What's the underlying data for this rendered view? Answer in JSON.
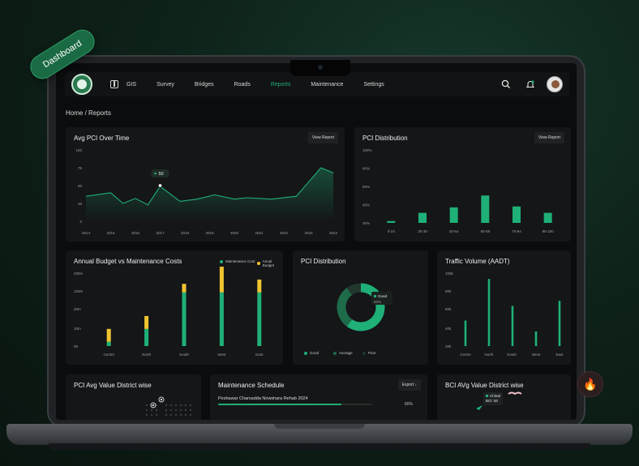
{
  "badge": "Dashboard",
  "nav": {
    "items": [
      {
        "label": "GIS",
        "active": false
      },
      {
        "label": "Survey",
        "active": false
      },
      {
        "label": "Bridges",
        "active": false
      },
      {
        "label": "Roads",
        "active": false
      },
      {
        "label": "Reports",
        "active": true
      },
      {
        "label": "Maintenance",
        "active": false
      },
      {
        "label": "Settings",
        "active": false
      }
    ]
  },
  "breadcrumb": "Home / Reports",
  "cards": {
    "avg_pci": {
      "title": "Avg PCI Over Time",
      "button": "View Report"
    },
    "pci_dist": {
      "title": "PCI Distribution",
      "button": "View Report"
    },
    "budget": {
      "title": "Annual Budget vs Maintenance Costs",
      "legend": [
        "Maintenance Cost",
        "Anual Budget"
      ]
    },
    "pci_donut": {
      "title": "PCI Distribution",
      "tooltip_label": "Good",
      "tooltip_value": "60%",
      "legend": [
        "Good",
        "Avorage",
        "Poor"
      ]
    },
    "traffic": {
      "title": "Traffic Volume (AADT)"
    },
    "pci_avg_district": {
      "title": "PCI Avg  Value District wise"
    },
    "schedule": {
      "title": "Maintenance Schedule",
      "button": "Export",
      "row_label": "Peshawar Charsadda Nowshara Rehab 2024",
      "row_value": "80%",
      "progress": 0.8
    },
    "bci_district": {
      "title": "BCI AVg Value District wise",
      "tooltip_label": "Chitral",
      "tooltip_value": "BCI: 50"
    }
  },
  "colors": {
    "accent": "#1fb077",
    "yellow": "#f0c431",
    "card": "#141618"
  },
  "chart_data": [
    {
      "type": "line",
      "title": "Avg PCI Over Time",
      "x": [
        "2014",
        "2015",
        "2016",
        "2017",
        "2018",
        "2019",
        "2020",
        "2021",
        "2022",
        "2023",
        "2024"
      ],
      "values": [
        35,
        40,
        25,
        32,
        23,
        49,
        28,
        31,
        37,
        31,
        33,
        31,
        35,
        75,
        68
      ],
      "point_x": [
        2014,
        2015,
        2015.5,
        2016,
        2016.5,
        2017,
        2017.8,
        2018.5,
        2019.2,
        2020,
        2020.5,
        2021.5,
        2022.5,
        2023.5,
        2024
      ],
      "annotation": {
        "label": "50",
        "x": 2017,
        "value": 50
      },
      "ylim": [
        0,
        100
      ],
      "yticks": [
        "0",
        "25",
        "50",
        "75",
        "100"
      ]
    },
    {
      "type": "bar",
      "title": "PCI Distribution",
      "categories": [
        "0-24",
        "25-39",
        "40-54",
        "55-69",
        "70-84",
        "85-100"
      ],
      "values": [
        22,
        31,
        37,
        50,
        38,
        31
      ],
      "ylim": [
        20,
        100
      ],
      "yticks": [
        "20%",
        "40%",
        "60%",
        "80%",
        "100%"
      ]
    },
    {
      "type": "bar",
      "title": "Annual Budget vs Maintenance Costs",
      "categories": [
        "Centre",
        "North",
        "South",
        "West",
        "East"
      ],
      "series": [
        {
          "name": "Maintenance Cost",
          "values": [
            10,
            40,
            125,
            125,
            125
          ]
        },
        {
          "name": "Anual Budget",
          "values": [
            30,
            30,
            20,
            60,
            30
          ]
        }
      ],
      "yticks": [
        "00",
        "10m",
        "40m",
        "100m",
        "200m"
      ]
    },
    {
      "type": "pie",
      "title": "PCI Distribution",
      "categories": [
        "Good",
        "Avorage",
        "Poor"
      ],
      "values": [
        60,
        30,
        10
      ]
    },
    {
      "type": "bar",
      "title": "Traffic Volume (AADT)",
      "categories": [
        "Centre",
        "North",
        "South",
        "West",
        "East"
      ],
      "values": [
        35,
        92,
        55,
        20,
        62,
        52
      ],
      "yticks": [
        "20k",
        "40k",
        "60k",
        "80k",
        "100k"
      ]
    }
  ]
}
